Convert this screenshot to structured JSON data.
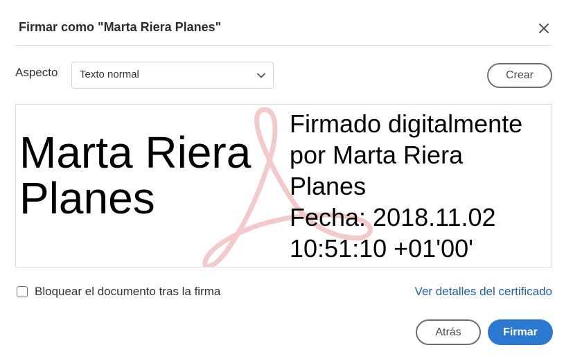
{
  "dialog": {
    "title": "Firmar como \"Marta Riera Planes\"",
    "close_icon": "close-icon"
  },
  "appearance": {
    "label": "Aspecto",
    "selected": "Texto normal",
    "create_label": "Crear"
  },
  "preview": {
    "name_line1": "Marta Riera",
    "name_line2": "Planes",
    "details": [
      "Firmado digitalmente",
      "por Marta Riera",
      "Planes",
      "Fecha: 2018.11.02",
      "10:51:10 +01'00'"
    ],
    "watermark_icon": "acrobat-logo-watermark",
    "watermark_color": "#f2c4c4"
  },
  "options": {
    "lock_label": "Bloquear el documento tras la firma",
    "lock_checked": false,
    "cert_link": "Ver detalles del certificado"
  },
  "footer": {
    "back_label": "Atrás",
    "sign_label": "Firmar"
  },
  "colors": {
    "primary": "#2b78d0",
    "link": "#1f5fa8"
  }
}
